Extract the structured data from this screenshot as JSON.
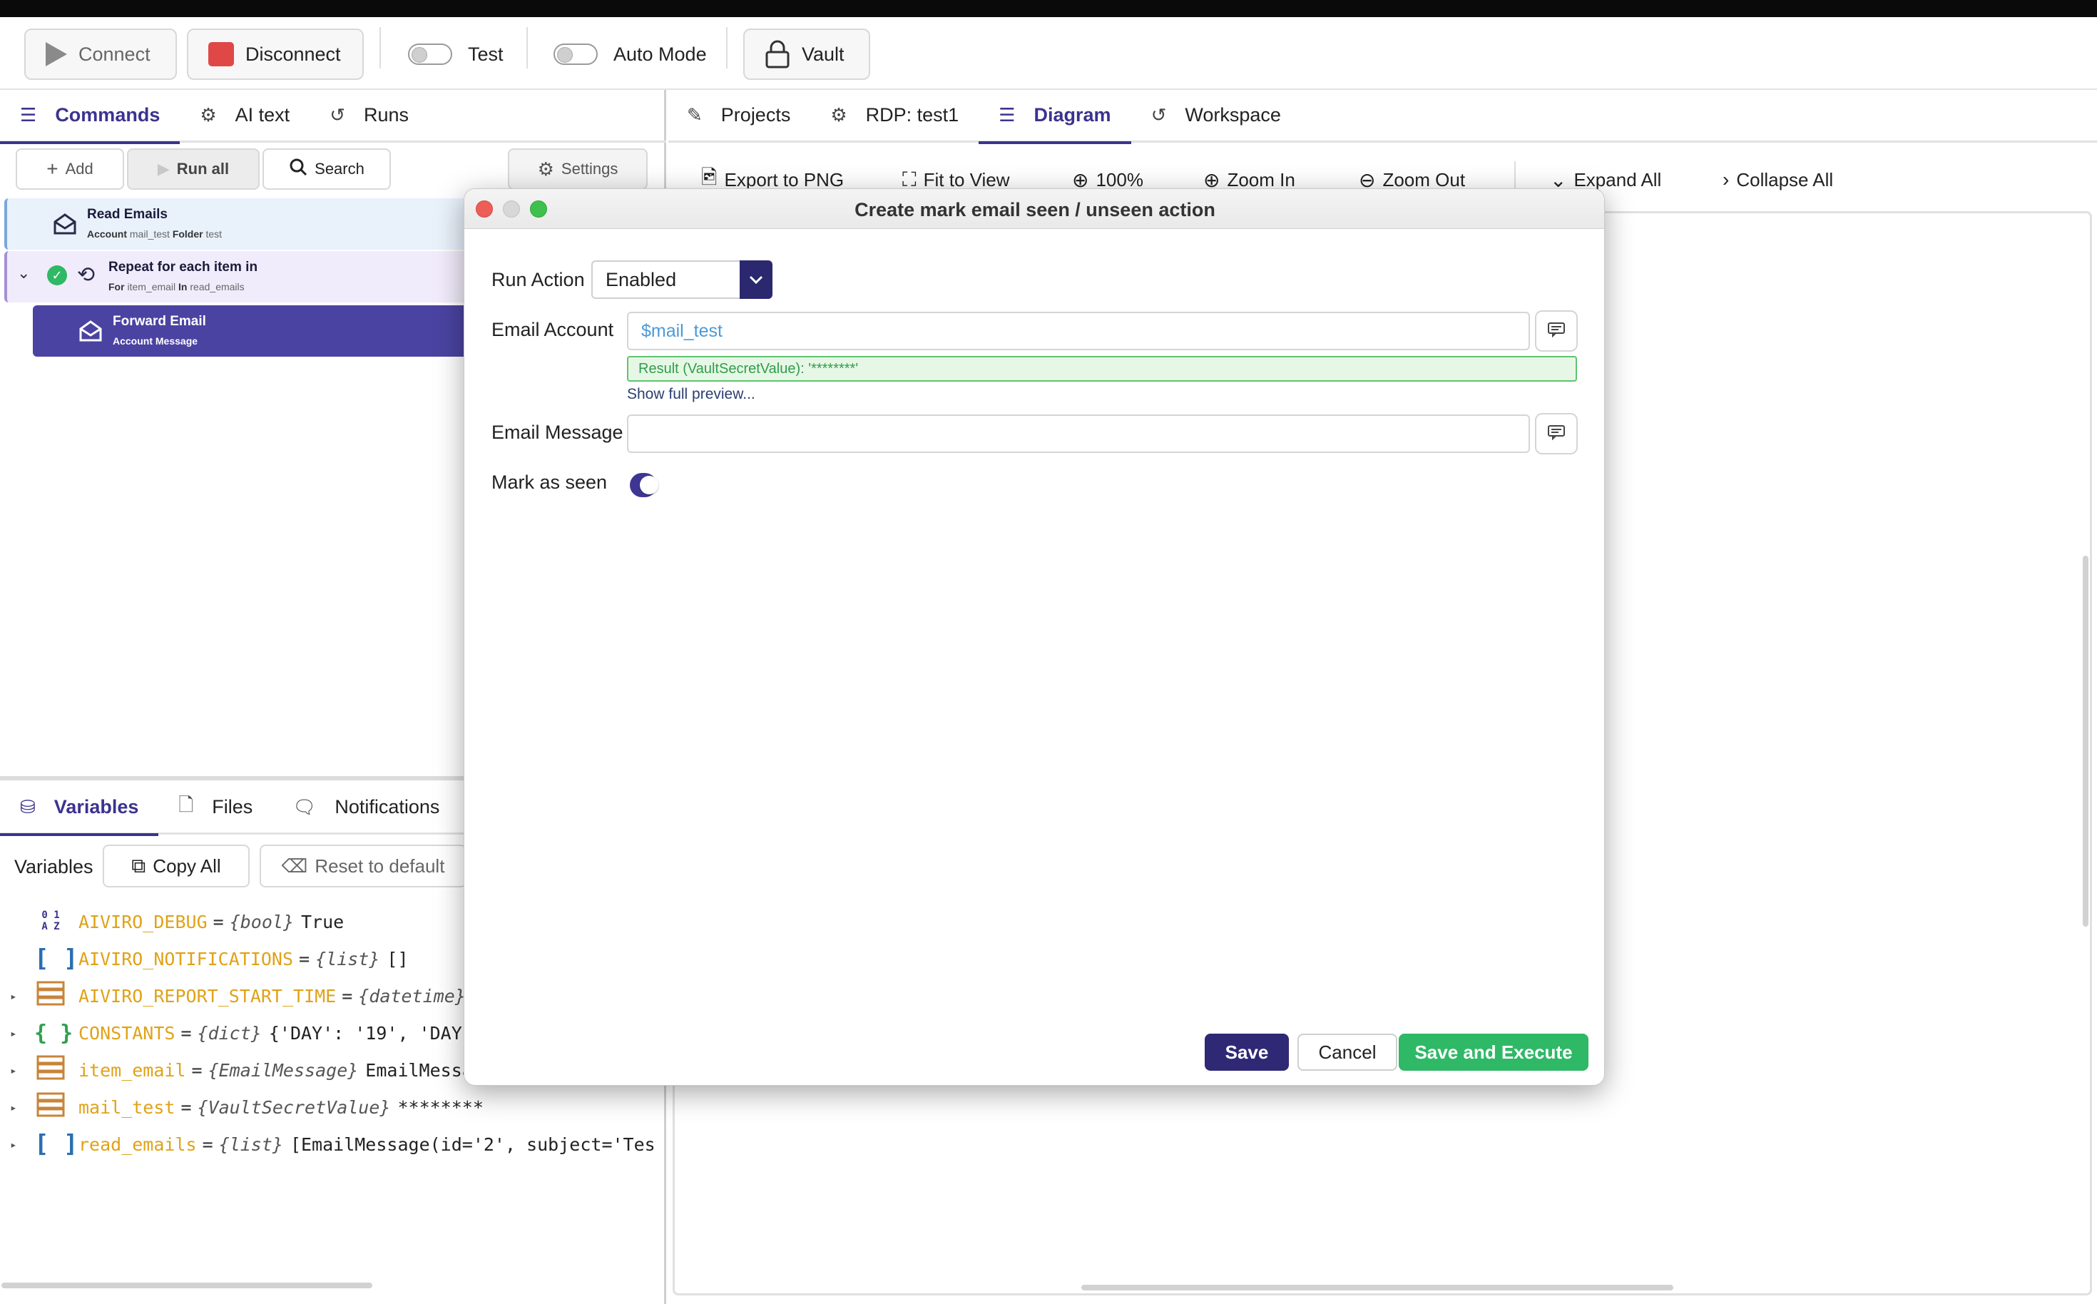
{
  "toolbar": {
    "connect_label": "Connect",
    "disconnect_label": "Disconnect",
    "test_label": "Test",
    "auto_mode_label": "Auto Mode",
    "vault_label": "Vault"
  },
  "left_tabs": [
    {
      "label": "Commands",
      "icon": "list-icon"
    },
    {
      "label": "AI text",
      "icon": "robot-icon"
    },
    {
      "label": "Runs",
      "icon": "history-icon"
    }
  ],
  "commands_toolbar": {
    "add_label": "Add",
    "run_all_label": "Run all",
    "search_label": "Search",
    "settings_label": "Settings"
  },
  "commands": [
    {
      "title": "Read Emails",
      "sub": [
        [
          "Account",
          "mail_test"
        ],
        [
          "Folder",
          "test"
        ]
      ]
    },
    {
      "title": "Repeat for each item in",
      "sub": [
        [
          "For",
          "item_email"
        ],
        [
          "In",
          "read_emails"
        ]
      ]
    },
    {
      "title": "Forward Email",
      "sub": [
        [
          "Account",
          ""
        ],
        [
          "Message",
          ""
        ]
      ]
    }
  ],
  "bottom_tabs": [
    {
      "label": "Variables",
      "icon": "database-icon"
    },
    {
      "label": "Files",
      "icon": "file-icon"
    },
    {
      "label": "Notifications",
      "icon": "message-icon"
    }
  ],
  "variables_toolbar": {
    "label": "Variables",
    "copy_all_label": "Copy All",
    "reset_label": "Reset to default"
  },
  "variables": [
    {
      "icon": "01AZ",
      "name": "AIVIRO_DEBUG",
      "type": "{bool}",
      "value": "True",
      "expandable": false
    },
    {
      "icon": "[ ]",
      "name": "AIVIRO_NOTIFICATIONS",
      "type": "{list}",
      "value": "[]",
      "expandable": false
    },
    {
      "icon": "obj",
      "name": "AIVIRO_REPORT_START_TIME",
      "type": "{datetime}",
      "value": "",
      "expandable": true
    },
    {
      "icon": "{ }",
      "name": "CONSTANTS",
      "type": "{dict}",
      "value": "{'DAY': '19', 'DAY",
      "expandable": true
    },
    {
      "icon": "obj",
      "name": "item_email",
      "type": "{EmailMessage}",
      "value": "EmailMessa",
      "expandable": true
    },
    {
      "icon": "obj",
      "name": "mail_test",
      "type": "{VaultSecretValue}",
      "value": "********",
      "expandable": true
    },
    {
      "icon": "[ ]",
      "name": "read_emails",
      "type": "{list}",
      "value": "[EmailMessage(id='2', subject='Tes",
      "expandable": true
    }
  ],
  "right_tabs": [
    {
      "label": "Projects",
      "icon": "file-sign-icon"
    },
    {
      "label": "RDP: test1",
      "icon": "robot-icon"
    },
    {
      "label": "Diagram",
      "icon": "list-icon"
    },
    {
      "label": "Workspace",
      "icon": "history-icon"
    }
  ],
  "diagram_toolbar": {
    "export_label": "Export to PNG",
    "fit_label": "Fit to View",
    "zoom_level": "100%",
    "zoom_in_label": "Zoom In",
    "zoom_out_label": "Zoom Out",
    "expand_label": "Expand All",
    "collapse_label": "Collapse All"
  },
  "dialog": {
    "title": "Create mark email seen / unseen action",
    "run_action_label": "Run Action",
    "run_action_value": "Enabled",
    "email_account_label": "Email Account",
    "email_account_value": "$mail_test",
    "result_text": "Result (VaultSecretValue): '********'",
    "show_preview_label": "Show full preview...",
    "email_message_label": "Email Message",
    "email_message_value": "",
    "mark_seen_label": "Mark as seen",
    "mark_seen_on": true,
    "save_label": "Save",
    "cancel_label": "Cancel",
    "save_execute_label": "Save and Execute"
  },
  "colors": {
    "accent": "#3b338f",
    "green": "#2fb866",
    "variable_name": "#e0a217"
  }
}
